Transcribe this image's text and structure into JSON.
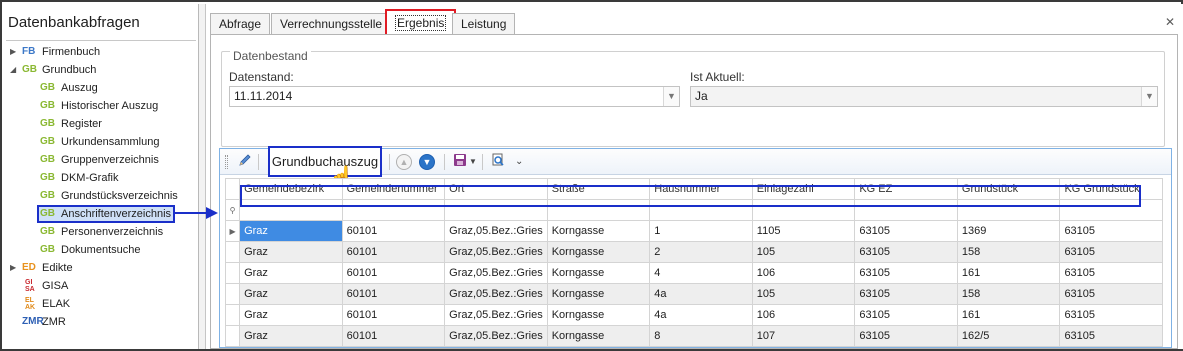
{
  "left_panel": {
    "title": "Datenbankabfragen",
    "tree": [
      {
        "abbr": "FB",
        "label": "Firmenbuch",
        "expander": "▶"
      },
      {
        "abbr": "GB",
        "label": "Grundbuch",
        "expander": "◢"
      },
      {
        "abbr": "GB",
        "label": "Auszug"
      },
      {
        "abbr": "GB",
        "label": "Historischer Auszug"
      },
      {
        "abbr": "GB",
        "label": "Register"
      },
      {
        "abbr": "GB",
        "label": "Urkundensammlung"
      },
      {
        "abbr": "GB",
        "label": "Gruppenverzeichnis"
      },
      {
        "abbr": "GB",
        "label": "DKM-Grafik"
      },
      {
        "abbr": "GB",
        "label": "Grundstücksverzeichnis"
      },
      {
        "abbr": "GB",
        "label": "Anschriftenverzeichnis"
      },
      {
        "abbr": "GB",
        "label": "Personenverzeichnis"
      },
      {
        "abbr": "GB",
        "label": "Dokumentsuche"
      },
      {
        "abbr": "ED",
        "label": "Edikte",
        "expander": "▶"
      },
      {
        "abbr_top": "GI",
        "abbr_bottom": "SA",
        "label": "GISA"
      },
      {
        "abbr_top": "EL",
        "abbr_bottom": "AK",
        "label": "ELAK"
      },
      {
        "abbr": "ZMR",
        "label": "ZMR"
      }
    ]
  },
  "tabs": [
    "Abfrage",
    "Verrechnungsstelle",
    "Ergebnis",
    "Leistung"
  ],
  "close_glyph": "✕",
  "datenbestand": {
    "legend": "Datenbestand",
    "datenstand_label": "Datenstand:",
    "datenstand_value": "11.11.2014",
    "ist_aktuell_label": "Ist Aktuell:",
    "ist_aktuell_value": "Ja"
  },
  "toolbar": {
    "grundbuchauszug_label": "Grundbuchauszug"
  },
  "table": {
    "columns": [
      "Gemeindebezirk",
      "Gemeindenummer",
      "Ort",
      "Straße",
      "Hausnummer",
      "Einlagezahl",
      "KG EZ",
      "Grundstück",
      "KG Grundstück"
    ],
    "rows": [
      [
        "Graz",
        "60101",
        "Graz,05.Bez.:Gries",
        "Korngasse",
        "1",
        "1105",
        "63105",
        "1369",
        "63105"
      ],
      [
        "Graz",
        "60101",
        "Graz,05.Bez.:Gries",
        "Korngasse",
        "2",
        "105",
        "63105",
        "158",
        "63105"
      ],
      [
        "Graz",
        "60101",
        "Graz,05.Bez.:Gries",
        "Korngasse",
        "4",
        "106",
        "63105",
        "161",
        "63105"
      ],
      [
        "Graz",
        "60101",
        "Graz,05.Bez.:Gries",
        "Korngasse",
        "4a",
        "105",
        "63105",
        "158",
        "63105"
      ],
      [
        "Graz",
        "60101",
        "Graz,05.Bez.:Gries",
        "Korngasse",
        "4a",
        "106",
        "63105",
        "161",
        "63105"
      ],
      [
        "Graz",
        "60101",
        "Graz,05.Bez.:Gries",
        "Korngasse",
        "8",
        "107",
        "63105",
        "162/5",
        "63105"
      ]
    ]
  },
  "colors": {
    "accent_blue": "#1a2fc9",
    "tab_highlight": "#e01b24",
    "gb_green": "#8ab832",
    "fb_blue": "#3c78c8",
    "ed_orange": "#e8921e",
    "selected_cell": "#3f8be3"
  },
  "icons": [
    "pencil-icon",
    "arrow-up-circle-icon",
    "arrow-down-circle-icon",
    "save-icon",
    "dropdown-icon",
    "search-document-icon",
    "chevron-down-icon",
    "hand-cursor-icon",
    "filter-icon",
    "row-pointer-icon"
  ]
}
